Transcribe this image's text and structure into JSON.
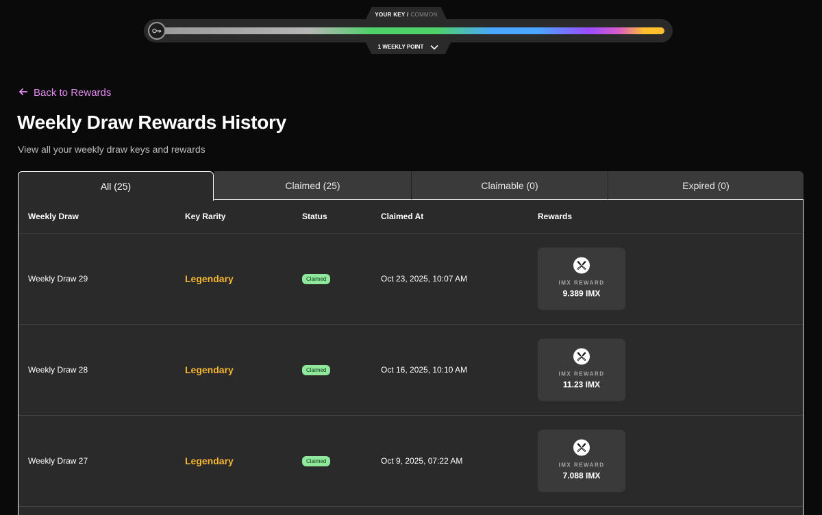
{
  "key_bar": {
    "label_prefix": "YOUR KEY /",
    "label_rarity": "COMMON",
    "points": "1 WEEKLY POINT",
    "key_icon": "key-icon",
    "chevron_icon": "chevron-down-icon"
  },
  "header": {
    "back_label": "Back to Rewards",
    "back_icon": "arrow-left-icon",
    "title": "Weekly Draw Rewards History",
    "subtitle": "View all your weekly draw keys and rewards"
  },
  "tabs": [
    {
      "label": "All (25)",
      "active": true
    },
    {
      "label": "Claimed (25)",
      "active": false
    },
    {
      "label": "Claimable (0)",
      "active": false
    },
    {
      "label": "Expired (0)",
      "active": false
    }
  ],
  "table": {
    "columns": [
      "Weekly Draw",
      "Key Rarity",
      "Status",
      "Claimed At",
      "Rewards"
    ],
    "rows": [
      {
        "draw": "Weekly Draw 29",
        "rarity": "Legendary",
        "status": "Claimed",
        "claimed_at": "Oct 23, 2025, 10:07 AM",
        "reward_label": "IMX REWARD",
        "reward_amount": "9.389 IMX"
      },
      {
        "draw": "Weekly Draw 28",
        "rarity": "Legendary",
        "status": "Claimed",
        "claimed_at": "Oct 16, 2025, 10:10 AM",
        "reward_label": "IMX REWARD",
        "reward_amount": "11.23 IMX"
      },
      {
        "draw": "Weekly Draw 27",
        "rarity": "Legendary",
        "status": "Claimed",
        "claimed_at": "Oct 9, 2025, 07:22 AM",
        "reward_label": "IMX REWARD",
        "reward_amount": "7.088 IMX"
      }
    ]
  },
  "colors": {
    "accent_link": "#e48cf0",
    "legendary": "#f5b731",
    "status_claimed_bg": "#8fe89c",
    "background": "#0a0a0a",
    "panel": "#2a2a2a"
  }
}
